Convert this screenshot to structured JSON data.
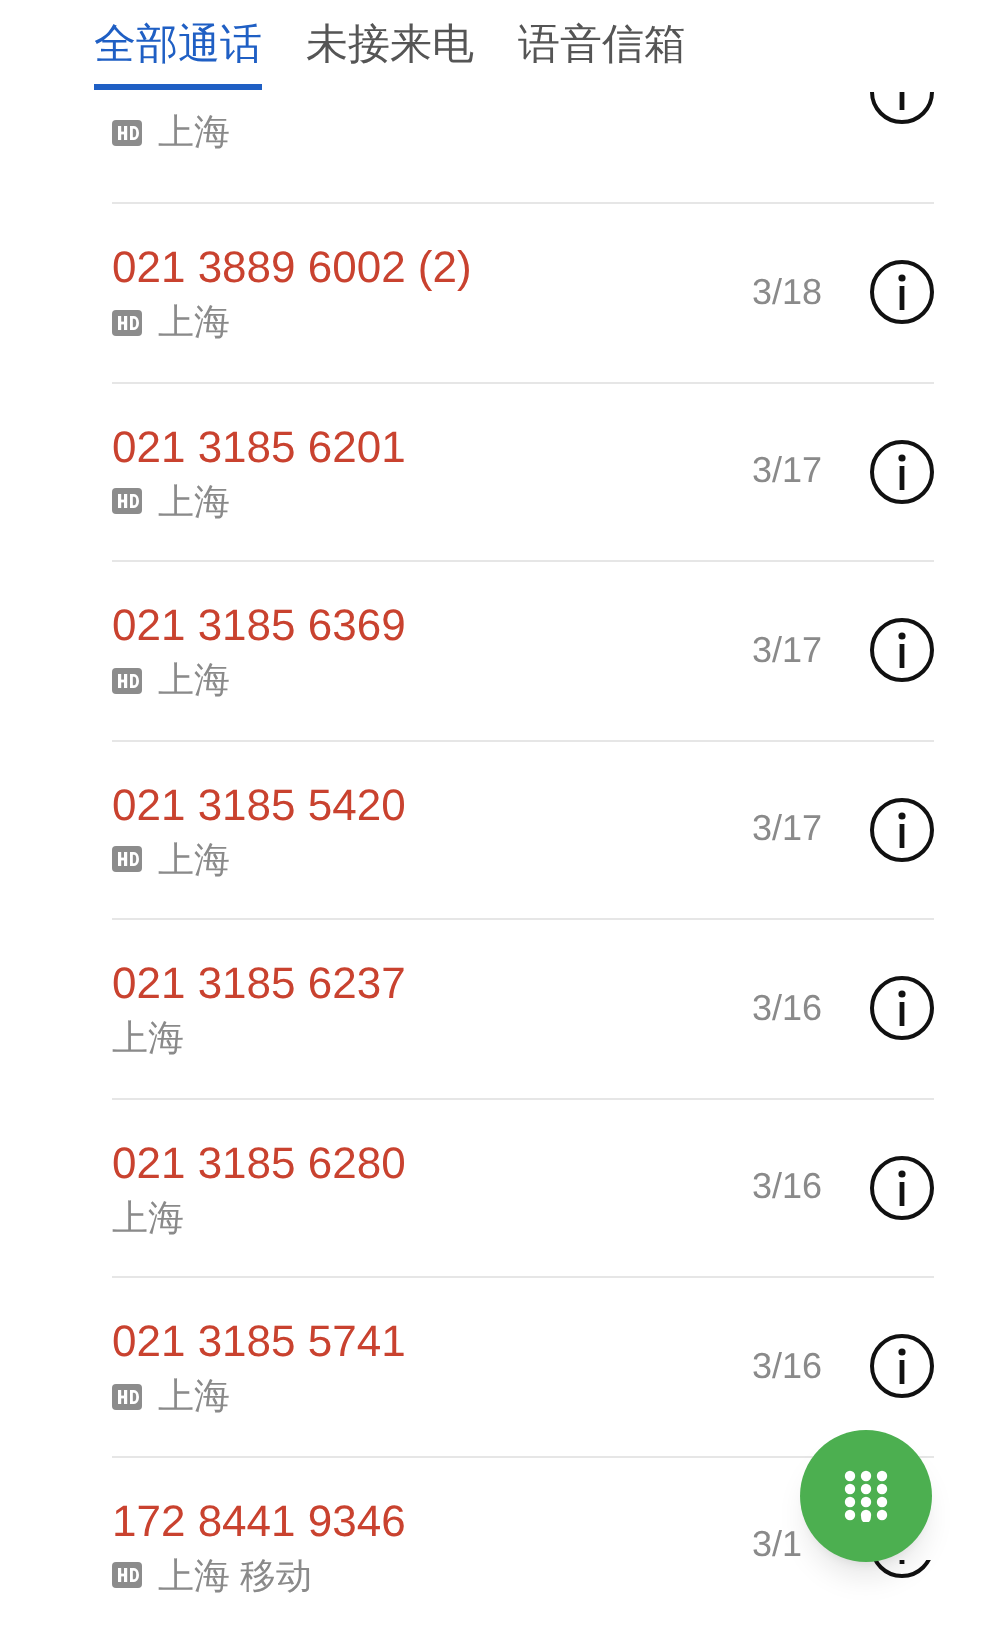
{
  "tabs": [
    {
      "label": "全部通话",
      "selected": true
    },
    {
      "label": "未接来电",
      "selected": false
    },
    {
      "label": "语音信箱",
      "selected": false
    }
  ],
  "calls": [
    {
      "kind": "partial",
      "hd": true,
      "location": "上海"
    },
    {
      "kind": "full",
      "number": "021 3889 6002 (2)",
      "hd": true,
      "location": "上海",
      "date": "3/18"
    },
    {
      "kind": "full",
      "number": "021 3185 6201",
      "hd": true,
      "location": "上海",
      "date": "3/17"
    },
    {
      "kind": "full",
      "number": "021 3185 6369",
      "hd": true,
      "location": "上海",
      "date": "3/17"
    },
    {
      "kind": "full",
      "number": "021 3185 5420",
      "hd": true,
      "location": "上海",
      "date": "3/17"
    },
    {
      "kind": "full",
      "number": "021 3185 6237",
      "hd": false,
      "location": "上海",
      "date": "3/16"
    },
    {
      "kind": "full",
      "number": "021 3185 6280",
      "hd": false,
      "location": "上海",
      "date": "3/16"
    },
    {
      "kind": "full",
      "number": "021 3185 5741",
      "hd": true,
      "location": "上海",
      "date": "3/16"
    },
    {
      "kind": "full",
      "number": "172 8441 9346",
      "hd": true,
      "location": "上海 移动",
      "date": "3/1"
    }
  ]
}
